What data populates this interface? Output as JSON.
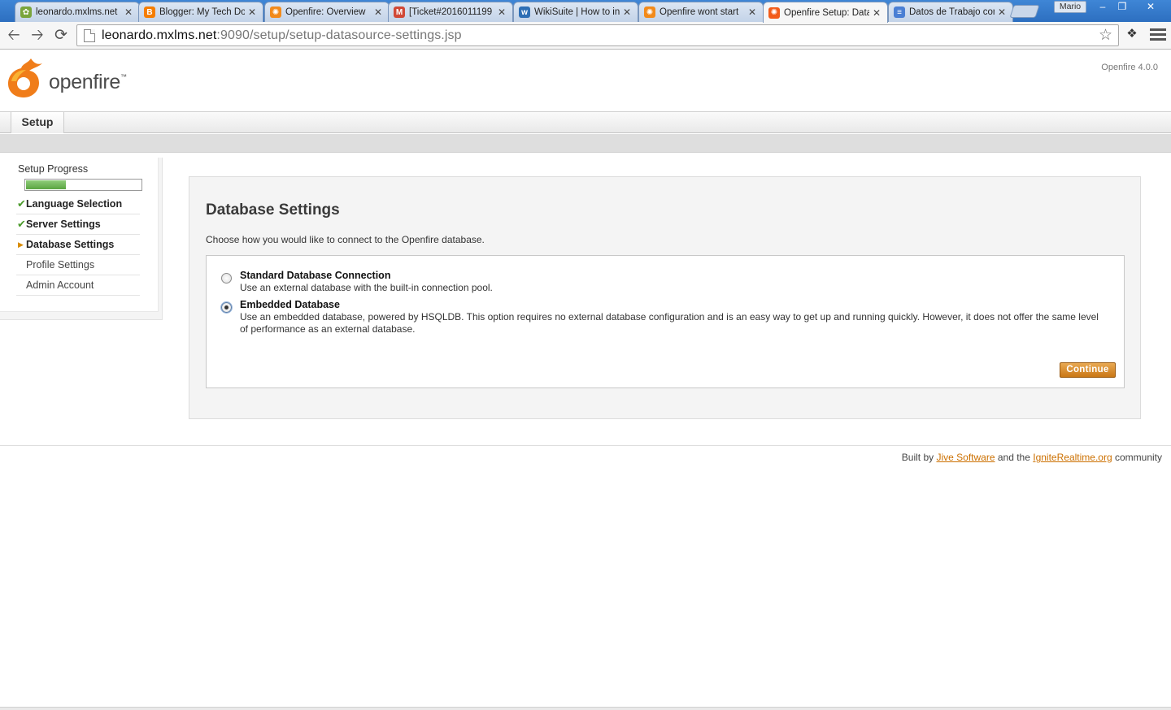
{
  "browser": {
    "tabs": [
      {
        "label": "leonardo.mxlms.net",
        "favicon": "leaf-icon",
        "color": "#7aa53c"
      },
      {
        "label": "Blogger: My Tech Doi",
        "favicon": "blogger-icon",
        "color": "#f57d00"
      },
      {
        "label": "Openfire: Overview",
        "favicon": "openfire-icon",
        "color": "#f28a1a"
      },
      {
        "label": "[Ticket#2016011199",
        "favicon": "gmail-icon",
        "color": "#d14836"
      },
      {
        "label": "WikiSuite | How to ins",
        "favicon": "wikisuite-icon",
        "color": "#2e6fb5"
      },
      {
        "label": "Openfire wont start",
        "favicon": "openfire-icon",
        "color": "#f28a1a"
      },
      {
        "label": "Openfire Setup: Data",
        "favicon": "openfire-icon",
        "color": "#f25c1a"
      },
      {
        "label": "Datos de Trabajo cor",
        "favicon": "docs-icon",
        "color": "#4a7fd4"
      }
    ],
    "active_tab_index": 6,
    "profile_name": "Mario",
    "url_host": "leonardo.mxlms.net",
    "url_rest": ":9090/setup/setup-datasource-settings.jsp"
  },
  "header": {
    "logo_text": "openfire",
    "logo_tm": "™",
    "version": "Openfire 4.0.0"
  },
  "nav": {
    "tab_label": "Setup"
  },
  "sidebar": {
    "progress_title": "Setup Progress",
    "progress_fraction": 0.35,
    "steps": [
      {
        "label": "Language Selection",
        "state": "done"
      },
      {
        "label": "Server Settings",
        "state": "done"
      },
      {
        "label": "Database Settings",
        "state": "current"
      },
      {
        "label": "Profile Settings",
        "state": "pending"
      },
      {
        "label": "Admin Account",
        "state": "pending"
      }
    ]
  },
  "main": {
    "title": "Database Settings",
    "description": "Choose how you would like to connect to the Openfire database.",
    "options": [
      {
        "title": "Standard Database Connection",
        "description": "Use an external database with the built-in connection pool.",
        "selected": false
      },
      {
        "title": "Embedded Database",
        "description": "Use an embedded database, powered by HSQLDB. This option requires no external database configuration and is an easy way to get up and running quickly. However, it does not offer the same level of performance as an external database.",
        "selected": true
      }
    ],
    "continue_label": "Continue"
  },
  "footer": {
    "built_by": "Built by",
    "jive_link": "Jive Software",
    "and_the": "and the",
    "ignite_link": "IgniteRealtime.org",
    "community": "community"
  },
  "colors": {
    "accent": "#cc7000",
    "progress": "#5aa441",
    "check": "#4b9a2b"
  }
}
